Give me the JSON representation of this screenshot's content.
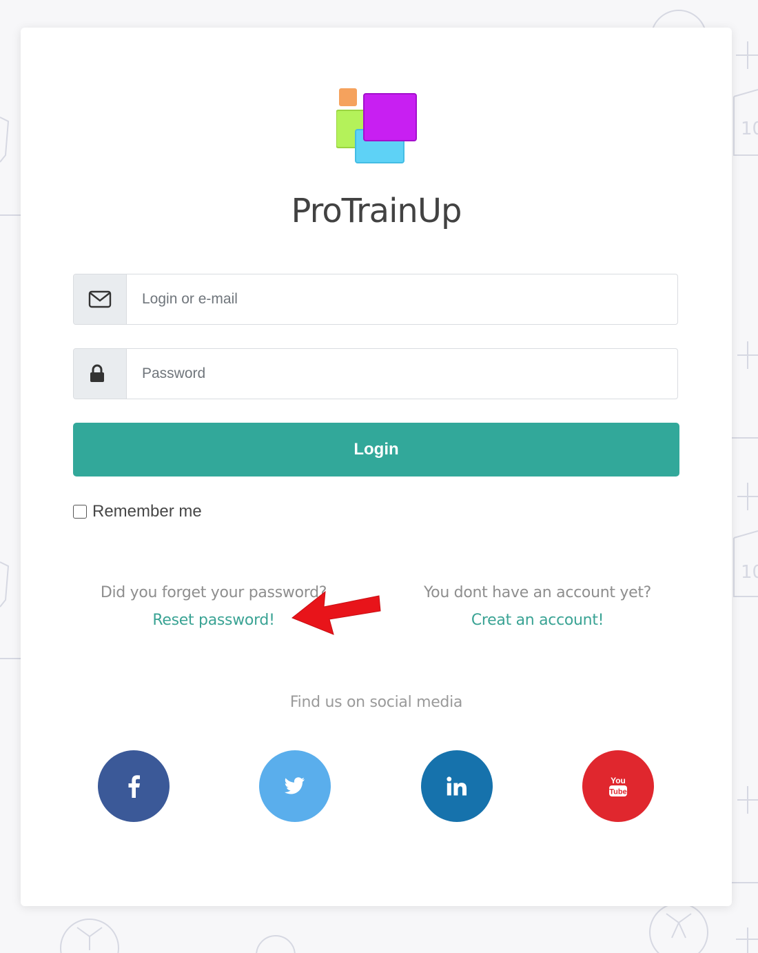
{
  "brand": {
    "name": "ProTrainUp"
  },
  "login_form": {
    "email_placeholder": "Login or e-mail",
    "password_placeholder": "Password",
    "login_label": "Login",
    "remember_label": "Remember me"
  },
  "help": {
    "forgot_question": "Did you forget your password?",
    "reset_link": "Reset password!",
    "account_question": "You dont have an account yet?",
    "create_link": "Creat an account!"
  },
  "social": {
    "title": "Find us on social media",
    "items": [
      {
        "name": "facebook",
        "icon": "facebook-icon",
        "color": "#3b5998"
      },
      {
        "name": "twitter",
        "icon": "twitter-icon",
        "color": "#5aaeec"
      },
      {
        "name": "linkedin",
        "icon": "linkedin-icon",
        "color": "#1672ac"
      },
      {
        "name": "youtube",
        "icon": "youtube-icon",
        "color": "#e0272e"
      }
    ]
  },
  "colors": {
    "primary": "#32a89a",
    "link": "#3aa394",
    "annotation_arrow": "#e8141a"
  }
}
